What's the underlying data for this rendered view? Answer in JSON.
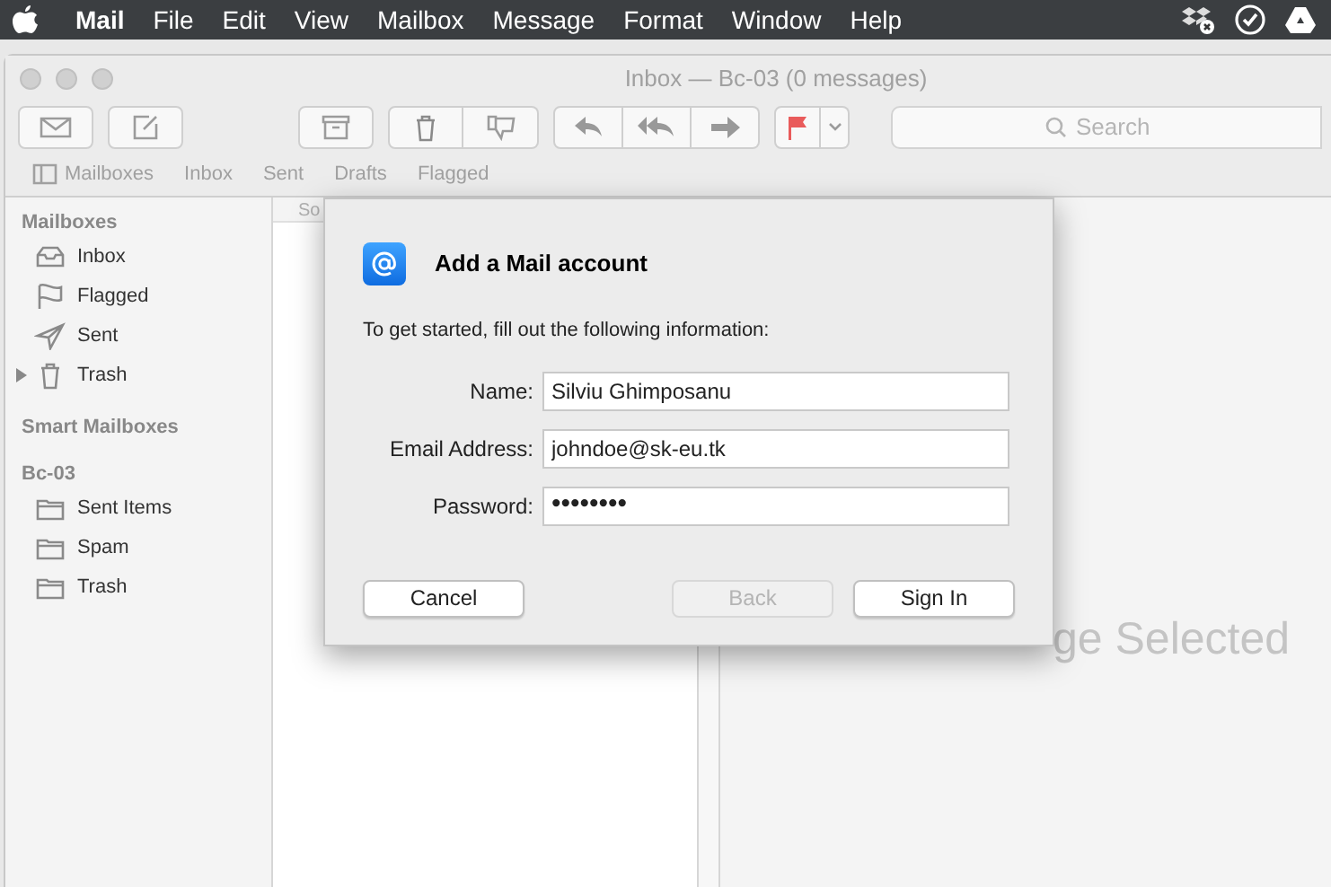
{
  "menu_bar": {
    "items": [
      {
        "label": "Mail",
        "bold": true
      },
      {
        "label": "File",
        "bold": false
      },
      {
        "label": "Edit",
        "bold": false
      },
      {
        "label": "View",
        "bold": false
      },
      {
        "label": "Mailbox",
        "bold": false
      },
      {
        "label": "Message",
        "bold": false
      },
      {
        "label": "Format",
        "bold": false
      },
      {
        "label": "Window",
        "bold": false
      },
      {
        "label": "Help",
        "bold": false
      }
    ]
  },
  "window": {
    "title": "Inbox — Bc-03 (0 messages)"
  },
  "search": {
    "placeholder": "Search"
  },
  "favorites_bar": {
    "items": [
      "Mailboxes",
      "Inbox",
      "Sent",
      "Drafts",
      "Flagged"
    ]
  },
  "sidebar": {
    "sections": [
      {
        "title": "Mailboxes",
        "items": [
          {
            "label": "Inbox",
            "kind": "inbox",
            "expandable": false
          },
          {
            "label": "Flagged",
            "kind": "flagged",
            "expandable": false
          },
          {
            "label": "Sent",
            "kind": "sent",
            "expandable": false
          },
          {
            "label": "Trash",
            "kind": "trash",
            "expandable": true
          }
        ]
      },
      {
        "title": "Smart Mailboxes"
      },
      {
        "title": "Bc-03",
        "items": [
          {
            "label": "Sent Items",
            "kind": "folder",
            "expandable": false
          },
          {
            "label": "Spam",
            "kind": "folder",
            "expandable": false
          },
          {
            "label": "Trash",
            "kind": "folder",
            "expandable": false
          }
        ]
      }
    ]
  },
  "message_list": {
    "sort_header": "So"
  },
  "viewer": {
    "empty_text": "ge Selected"
  },
  "dialog": {
    "title": "Add a Mail account",
    "intro": "To get started, fill out the following information:",
    "fields": [
      {
        "label": "Name:",
        "value": "Silviu Ghimposanu",
        "kind": "text"
      },
      {
        "label": "Email Address:",
        "value": "johndoe@sk-eu.tk",
        "kind": "text"
      },
      {
        "label": "Password:",
        "value": "••••••••",
        "kind": "password"
      }
    ],
    "buttons": [
      {
        "label": "Cancel",
        "disabled": false
      },
      {
        "label": "Back",
        "disabled": true
      },
      {
        "label": "Sign In",
        "disabled": false
      }
    ]
  }
}
